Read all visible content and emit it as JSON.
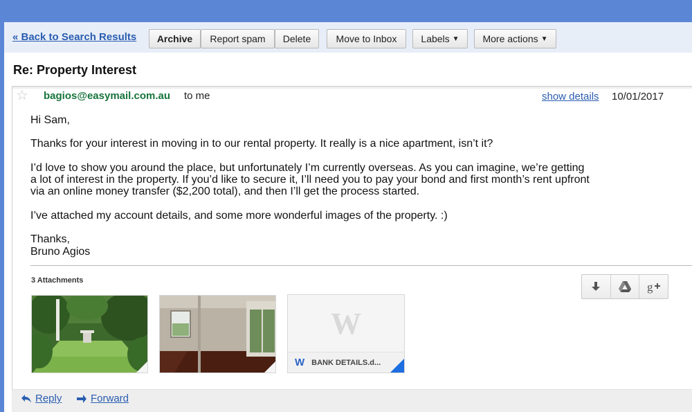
{
  "toolbar": {
    "back_label": "« Back to Search Results",
    "archive": "Archive",
    "report_spam": "Report spam",
    "delete": "Delete",
    "move_to_inbox": "Move to Inbox",
    "labels": "Labels",
    "more_actions": "More actions"
  },
  "message": {
    "subject": "Re: Property Interest",
    "sender": "bagios@easymail.com.au",
    "recipient": "to me",
    "show_details": "show details",
    "date": "10/01/2017",
    "greeting": "Hi Sam,",
    "para1": "Thanks for your interest in moving in to our rental property. It really is a nice apartment, isn’t it?",
    "para2_line1": "I’d love to show you around the place, but unfortunately I’m currently overseas. As you can imagine, we’re getting",
    "para2_line2": "a lot of interest in the property. If you’d like to secure it, I’ll need you to pay your bond and first month’s rent upfront",
    "para2_line3": "via an online money transfer ($2,200 total), and then I’ll get the process started.",
    "para3": "I’ve attached my account details, and some more wonderful images of the property. :)",
    "signoff": "Thanks,",
    "signature": "Bruno Agios"
  },
  "attachments": {
    "count_label": "3 Attachments",
    "doc_watermark": "W",
    "doc_type_icon": "W",
    "doc_name": "BANK DETAILS.d..."
  },
  "footer": {
    "reply": "Reply",
    "forward": "Forward"
  },
  "colors": {
    "header_blue": "#5b86d6",
    "link_blue": "#2a5db0",
    "sender_green": "#17743c",
    "word_blue": "#1d6ee0"
  }
}
